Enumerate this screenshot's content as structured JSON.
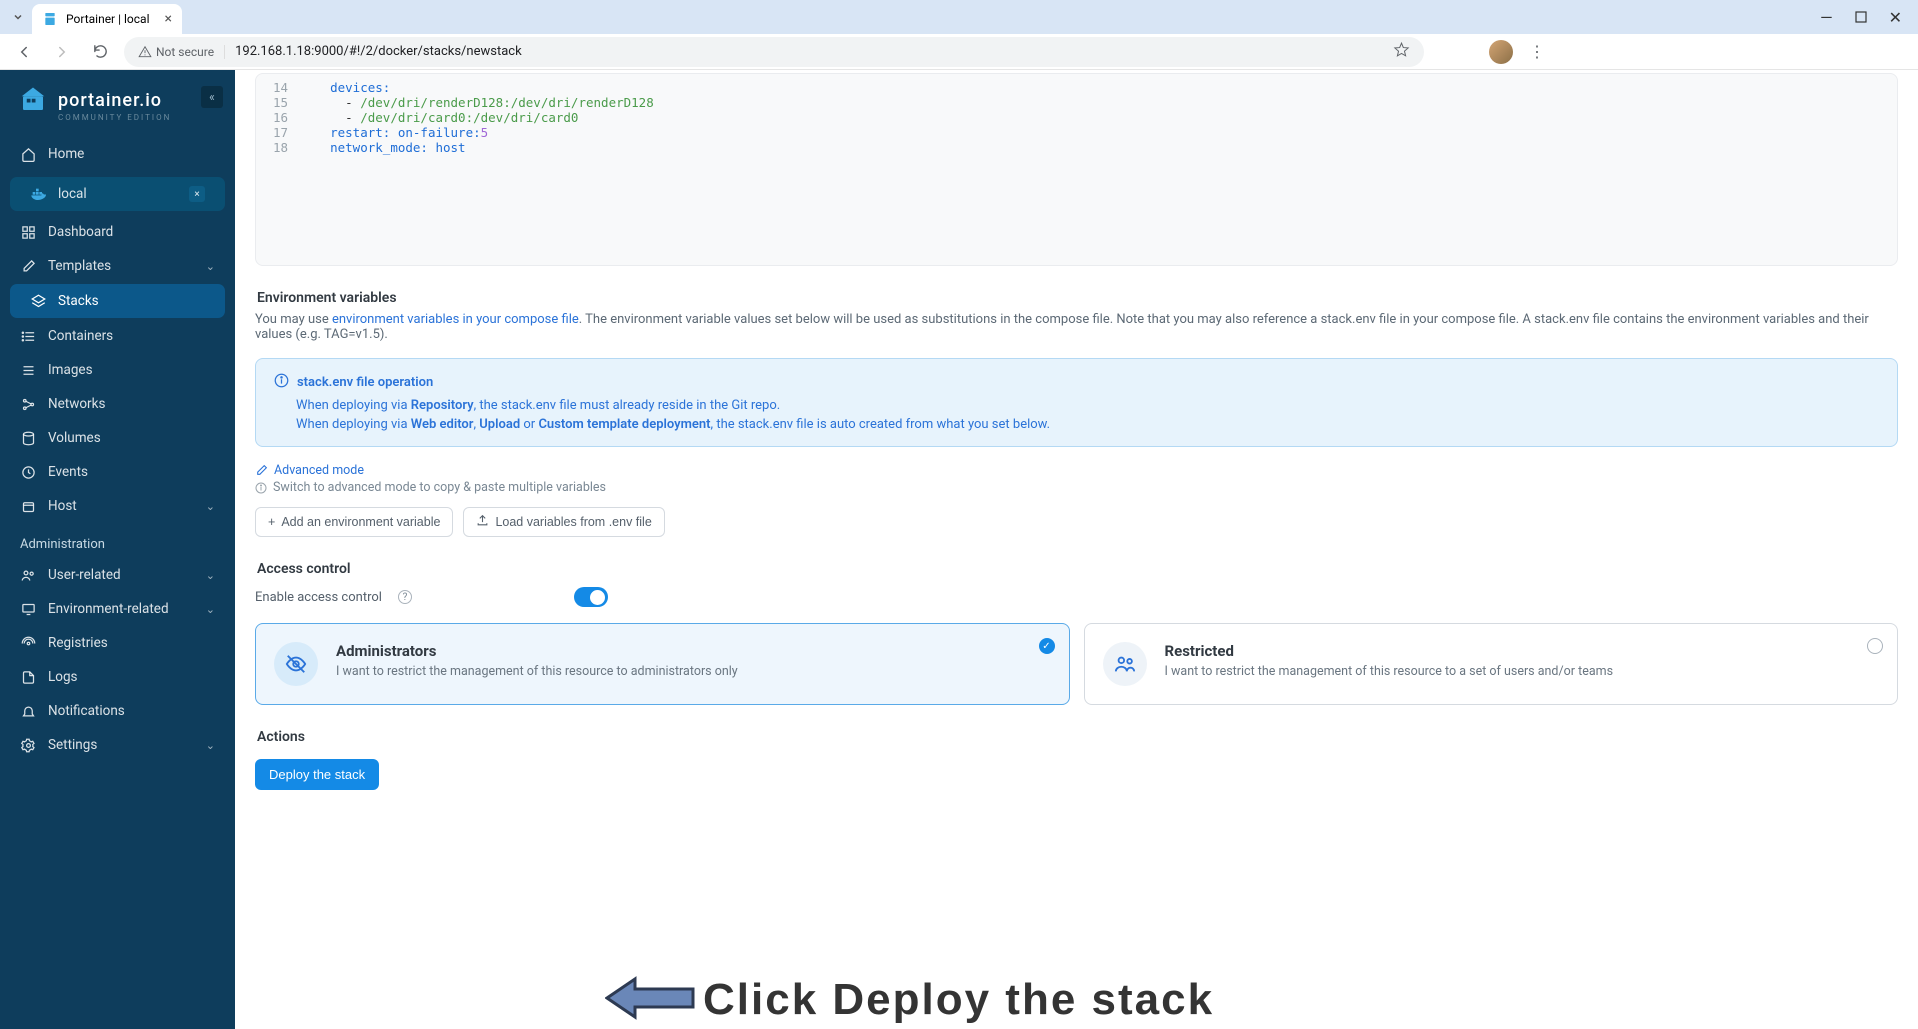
{
  "browser": {
    "tab_title": "Portainer | local",
    "not_secure": "Not secure",
    "url": "192.168.1.18:9000/#!/2/docker/stacks/newstack"
  },
  "sidebar": {
    "logo_text": "portainer.io",
    "logo_sub": "COMMUNITY EDITION",
    "home": "Home",
    "env_label": "local",
    "items": [
      {
        "label": "Dashboard",
        "icon": "grid"
      },
      {
        "label": "Templates",
        "icon": "edit",
        "expand": true
      },
      {
        "label": "Stacks",
        "icon": "layers",
        "active": true
      },
      {
        "label": "Containers",
        "icon": "list"
      },
      {
        "label": "Images",
        "icon": "image"
      },
      {
        "label": "Networks",
        "icon": "share"
      },
      {
        "label": "Volumes",
        "icon": "database"
      },
      {
        "label": "Events",
        "icon": "clock"
      },
      {
        "label": "Host",
        "icon": "box",
        "expand": true
      }
    ],
    "admin_title": "Administration",
    "admin_items": [
      {
        "label": "User-related",
        "icon": "users",
        "expand": true
      },
      {
        "label": "Environment-related",
        "icon": "monitor",
        "expand": true
      },
      {
        "label": "Registries",
        "icon": "broadcast"
      },
      {
        "label": "Logs",
        "icon": "file"
      },
      {
        "label": "Notifications",
        "icon": "bell"
      },
      {
        "label": "Settings",
        "icon": "gear",
        "expand": true
      }
    ]
  },
  "editor": {
    "lines": [
      {
        "n": "14",
        "indent": "    ",
        "key": "devices",
        "rest": ":"
      },
      {
        "n": "15",
        "indent": "      ",
        "dash": "- ",
        "str": "/dev/dri/renderD128:/dev/dri/renderD128"
      },
      {
        "n": "16",
        "indent": "      ",
        "dash": "- ",
        "str": "/dev/dri/card0:/dev/dri/card0"
      },
      {
        "n": "17",
        "indent": "    ",
        "key": "restart",
        "val": ": on-failure:",
        "num": "5"
      },
      {
        "n": "18",
        "indent": "    ",
        "key": "network_mode",
        "val": ": host"
      }
    ]
  },
  "env_section": {
    "title": "Environment variables",
    "desc_1": "You may use ",
    "desc_link": "environment variables in your compose file",
    "desc_2": ". The environment variable values set below will be used as substitutions in the compose file. Note that you may also reference a stack.env file in your compose file. A stack.env file contains the environment variables and their values (e.g. TAG=v1.5).",
    "info_title": "stack.env file operation",
    "info_line1_a": "When deploying via ",
    "info_line1_b": "Repository",
    "info_line1_c": ", the stack.env file must already reside in the Git repo.",
    "info_line2_a": "When deploying via ",
    "info_line2_b": "Web editor",
    "info_line2_c": ", ",
    "info_line2_d": "Upload",
    "info_line2_e": " or ",
    "info_line2_f": "Custom template deployment",
    "info_line2_g": ", the stack.env file is auto created from what you set below.",
    "adv_mode": "Advanced mode",
    "adv_hint": "Switch to advanced mode to copy & paste multiple variables",
    "add_btn": "Add an environment variable",
    "load_btn": "Load variables from .env file"
  },
  "access": {
    "title": "Access control",
    "toggle_label": "Enable access control",
    "admin_title": "Administrators",
    "admin_desc": "I want to restrict the management of this resource to administrators only",
    "restricted_title": "Restricted",
    "restricted_desc": "I want to restrict the management of this resource to a set of users and/or teams"
  },
  "actions": {
    "title": "Actions",
    "deploy": "Deploy the stack"
  },
  "annotation": "Click Deploy the stack"
}
